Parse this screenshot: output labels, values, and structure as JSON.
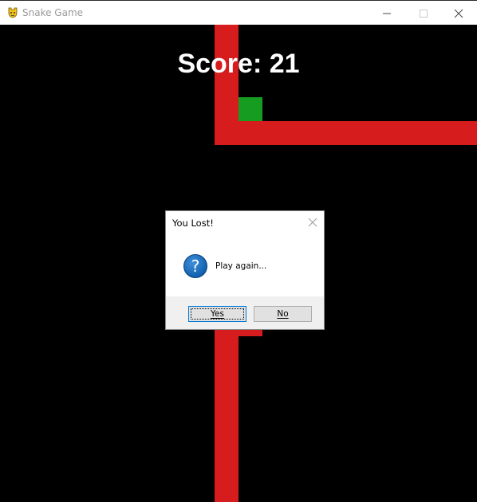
{
  "window": {
    "title": "Snake Game",
    "controls": [
      "minimize",
      "maximize",
      "close"
    ]
  },
  "game": {
    "score_text": "Score: 21",
    "colors": {
      "background": "#000000",
      "snake": "#d61c1c",
      "food": "#179c22",
      "score": "#ffffff"
    }
  },
  "dialog": {
    "title": "You Lost!",
    "message": "Play again...",
    "icon": "question-icon",
    "buttons": {
      "yes": "Yes",
      "no": "No"
    }
  }
}
